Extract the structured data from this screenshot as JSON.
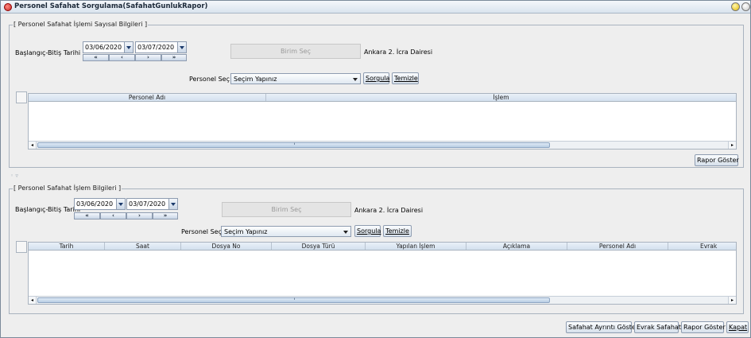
{
  "window": {
    "title": "Personel Safahat Sorgulama(SafahatGunlukRapor)"
  },
  "section1": {
    "group_title": "Personel Safahat İşlemi  Sayısal Bilgileri",
    "date_label": "Başlangıç-Bitiş Tarihi",
    "start_date": "03/06/2020",
    "end_date": "03/07/2020",
    "nav": [
      "«",
      "‹",
      "›",
      "»"
    ],
    "birim_button": "Birim Seç",
    "birim_value": "Ankara 2. İcra Dairesi",
    "personel_label": "Personel Seç",
    "personel_selected": "Seçim Yapınız",
    "sorgula": "Sorgula",
    "temizle": "Temizle",
    "columns": [
      "Personel Adı",
      "İşlem"
    ],
    "rapor_goster": "Rapor Göster"
  },
  "section2": {
    "group_title": "Personel Safahat İşlem Bilgileri",
    "date_label": "Başlangıç-Bitiş Tarihi",
    "start_date": "03/06/2020",
    "end_date": "03/07/2020",
    "nav": [
      "«",
      "‹",
      "›",
      "»"
    ],
    "birim_button": "Birim Seç",
    "birim_value": "Ankara 2. İcra Dairesi",
    "personel_label": "Personel Seç",
    "personel_selected": "Seçim Yapınız",
    "sorgula": "Sorgula",
    "temizle": "Temizle",
    "columns": [
      "Tarih",
      "Saat",
      "Dosya No",
      "Dosya Türü",
      "Yapılan İşlem",
      "Açıklama",
      "Personel Adı",
      "Evrak"
    ]
  },
  "footer": {
    "safahat_ayrinti": "Safahat Ayrıntı Göster",
    "evrak_safahat": "Evrak Safahat",
    "rapor_goster": "Rapor Göster",
    "kapat": "Kapat"
  },
  "splitter": "◦ ▿",
  "colors": {
    "titlebar": "#d9e3ee",
    "background": "#eeeeee",
    "table_header": "#d3e0ee"
  }
}
